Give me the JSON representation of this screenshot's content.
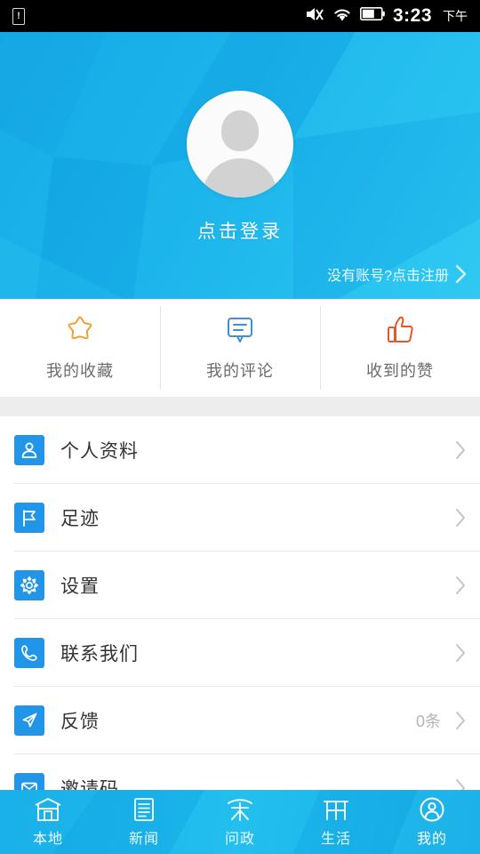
{
  "status_bar": {
    "sim_icon": "sim-warning-icon",
    "mute_icon": "mute-icon",
    "wifi_icon": "wifi-icon",
    "battery_icon": "battery-icon",
    "time": "3:23",
    "ampm": "下午"
  },
  "header": {
    "avatar_icon": "default-avatar-icon",
    "login_label": "点击登录",
    "register_label": "没有账号?点击注册",
    "register_chevron": "chevron-right-icon",
    "bg_color_start": "#0fa3e3",
    "bg_color_end": "#2ec8f2"
  },
  "quick_actions": [
    {
      "label": "我的收藏",
      "icon": "star-outline-icon",
      "color": "#f0a030"
    },
    {
      "label": "我的评论",
      "icon": "comment-bubble-icon",
      "color": "#3d8fd8"
    },
    {
      "label": "收到的赞",
      "icon": "thumbs-up-icon",
      "color": "#e2582a"
    }
  ],
  "list": [
    {
      "label": "个人资料",
      "icon": "person-icon",
      "meta": "",
      "chevron": "chevron-right-icon"
    },
    {
      "label": "足迹",
      "icon": "flag-icon",
      "meta": "",
      "chevron": "chevron-right-icon"
    },
    {
      "label": "设置",
      "icon": "gear-icon",
      "meta": "",
      "chevron": "chevron-right-icon"
    },
    {
      "label": "联系我们",
      "icon": "phone-icon",
      "meta": "",
      "chevron": "chevron-right-icon"
    },
    {
      "label": "反馈",
      "icon": "paper-plane-icon",
      "meta": "0条",
      "chevron": "chevron-right-icon"
    },
    {
      "label": "邀请码",
      "icon": "invite-icon",
      "meta": "",
      "chevron": "chevron-right-icon"
    }
  ],
  "list_icon_color": "#2196e8",
  "tabbar": [
    {
      "label": "本地",
      "icon": "local-gate-icon",
      "active": false
    },
    {
      "label": "新闻",
      "icon": "news-book-icon",
      "active": false
    },
    {
      "label": "问政",
      "icon": "government-arch-icon",
      "active": false
    },
    {
      "label": "生活",
      "icon": "life-gate-icon",
      "active": false
    },
    {
      "label": "我的",
      "icon": "profile-person-circle-icon",
      "active": true
    }
  ]
}
